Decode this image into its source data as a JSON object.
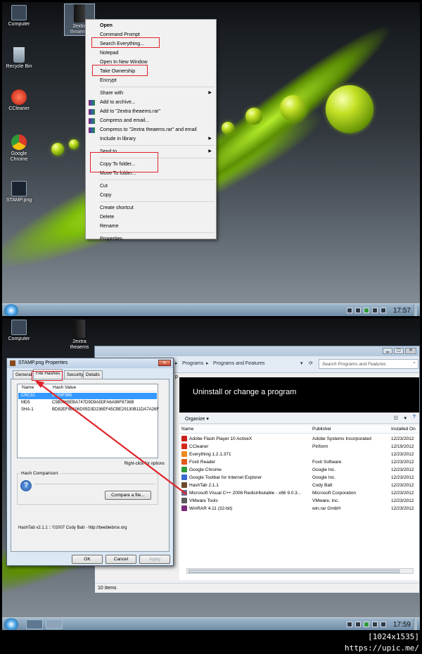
{
  "desktop_top": {
    "icons": [
      {
        "label": "Computer",
        "color": "#3a4656"
      },
      {
        "label": "Recycle Bin",
        "color": "#8da3b6"
      },
      {
        "label": "CCleaner",
        "color": "#d22a1a"
      },
      {
        "label": "Google Chrome",
        "color": "#2f9a3a"
      },
      {
        "label": "STAMP.png",
        "color": "#1b2330"
      }
    ],
    "selected_folder": {
      "label_1": "2extra",
      "label_2": "theaems"
    },
    "clock": "17:57"
  },
  "context_menu": {
    "items": [
      {
        "label": "Open",
        "bold": true
      },
      {
        "label": "Command Prompt"
      },
      {
        "label": "Search Everything...",
        "highlight": true
      },
      {
        "label": "Notepad"
      },
      {
        "label": "Open In New Window"
      },
      {
        "label": "Take Ownership",
        "highlight": true
      },
      {
        "label": "Encrypt"
      },
      {
        "sep": true
      },
      {
        "label": "Share with",
        "submenu": true
      },
      {
        "label": "Add to archive...",
        "rar": true
      },
      {
        "label": "Add to \"2extra theaems.rar\"",
        "rar": true
      },
      {
        "label": "Compress and email...",
        "rar": true
      },
      {
        "label": "Compress to \"2extra theaems.rar\" and email",
        "rar": true
      },
      {
        "label": "Include in library",
        "submenu": true
      },
      {
        "sep": true
      },
      {
        "label": "Send to",
        "submenu": true
      },
      {
        "sep": true
      },
      {
        "label": "Copy To folder...",
        "highlight": true
      },
      {
        "label": "Move To folder...",
        "highlight": true
      },
      {
        "sep": true
      },
      {
        "label": "Cut"
      },
      {
        "label": "Copy"
      },
      {
        "sep": true
      },
      {
        "label": "Create shortcut"
      },
      {
        "label": "Delete"
      },
      {
        "label": "Rename"
      },
      {
        "sep": true
      },
      {
        "label": "Properties"
      }
    ]
  },
  "desktop_bottom": {
    "icons": [
      {
        "label": "Computer"
      }
    ],
    "folder": {
      "label_1": "2extra",
      "label_2": "theaems"
    },
    "clock": "17:59"
  },
  "control_panel": {
    "breadcrumb": [
      "Programs",
      "Programs and Features"
    ],
    "search_placeholder": "Search Programs and Features",
    "sidebar_fragment": "p",
    "heading": "Uninstall or change a program",
    "organize_label": "Organize",
    "columns": [
      "Name",
      "Publisher",
      "Installed On"
    ],
    "programs": [
      {
        "name": "Adobe Flash Player 10 ActiveX",
        "publisher": "Adobe Systems Incorporated",
        "date": "12/23/2012",
        "color": "#c8201a"
      },
      {
        "name": "CCleaner",
        "publisher": "Piriform",
        "date": "12/19/2012",
        "color": "#d22a1a"
      },
      {
        "name": "Everything 1.2.1.371",
        "publisher": "",
        "date": "12/23/2012",
        "color": "#f08a1a"
      },
      {
        "name": "Foxit Reader",
        "publisher": "Foxit Software",
        "date": "12/23/2012",
        "color": "#e05a1a"
      },
      {
        "name": "Google Chrome",
        "publisher": "Google Inc.",
        "date": "12/23/2012",
        "color": "#2f9a3a"
      },
      {
        "name": "Google Toolbar for Internet Explorer",
        "publisher": "Google Inc.",
        "date": "12/23/2012",
        "color": "#3a6ad0"
      },
      {
        "name": "HashTab 2.1.1",
        "publisher": "Cody Batt",
        "date": "12/23/2012",
        "color": "#6a4a2a"
      },
      {
        "name": "Microsoft Visual C++ 2008 Redistributable - x86 9.0.3...",
        "publisher": "Microsoft Corporation",
        "date": "12/23/2012",
        "color": "#6a6a8a"
      },
      {
        "name": "VMware Tools",
        "publisher": "VMware, Inc.",
        "date": "12/23/2012",
        "color": "#5a5a5a"
      },
      {
        "name": "WinRAR 4.11 (32-bit)",
        "publisher": "win.rar GmbH",
        "date": "12/23/2012",
        "color": "#7a2a7a"
      }
    ],
    "status": "10 items"
  },
  "properties_dialog": {
    "title": "STAMP.png Properties",
    "tabs": [
      "General",
      "File Hashes",
      "Security",
      "Details"
    ],
    "active_tab": "File Hashes",
    "columns": [
      "Name",
      "Hash Value"
    ],
    "hashes": [
      {
        "name": "CRC32",
        "value": "B1E6F965",
        "selected": true
      },
      {
        "name": "MD5",
        "value": "C5B0065EBA747D9D9A5DFA6A98F8736B"
      },
      {
        "name": "SHA-1",
        "value": "BD82EF96106D05D3D236EF45CBE29130B11DA7A26F"
      }
    ],
    "right_click_hint": "Right-click for options",
    "hash_comparison_label": "Hash Comparison:",
    "compare_button": "Compare a file...",
    "footer": "HashTab v2.1.1 :: ©2007 Cody Batt - http://beeblebrox.org",
    "ok": "OK",
    "cancel": "Cancel",
    "apply": "Apply"
  },
  "watermark": "[1024x1535] https://upic.me/"
}
